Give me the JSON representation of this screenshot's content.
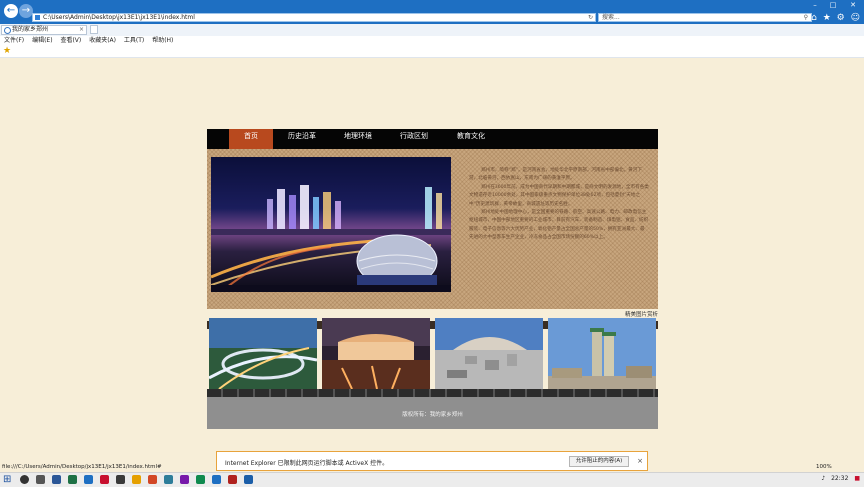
{
  "browser": {
    "address": "C:\\Users\\Admin\\Desktop\\jx13E1\\jx13E1\\index.html",
    "search_placeholder": "搜索...",
    "tab_title": "我的家乡郑州",
    "menu": [
      "文件(F)",
      "编辑(E)",
      "查看(V)",
      "收藏夹(A)",
      "工具(T)",
      "帮助(H)"
    ]
  },
  "site": {
    "nav": [
      "首页",
      "历史沿革",
      "地理环境",
      "行政区划",
      "教育文化"
    ],
    "active_nav": "首页",
    "intro": [
      "郑州市，简称“郑”，是河南省会，地处华北平原南部，河南省中部偏北，黄河下游，北临黄河，西依嵩山，东南为广阔的黄淮平原。",
      "郑州在3600年前，成为中国商代早期和中期都城，是商文明的发源地，全市有各类文物遗存近10000余处，其中国家级重点文物保护单位38处62项，包括夏封“天地之中”历史建筑群，黄帝故里，商城遗址等历史名胜。",
      "郑州地处中国地理中心，是全国重要的铁路、航空、高速公路、电力、邮政电信主枢纽城市，中国中部地区重要的工业城市，目前有汽车、装备制造、煤电铝、食品、纺织服装、电子信息等六大优势产业，氧化铝产量占全国总产量的50%，拥有亚洲最大、最先进的大中型客车生产企业，冷冻食品占全国市场份额的60%以上。"
    ],
    "more_link": "精美图片赏析",
    "copyright": "版权所有：我的家乡郑州"
  },
  "notification": {
    "text": "Internet Explorer 已限制此网页运行脚本或 ActiveX 控件。",
    "button": "允许阻止的内容(A)"
  },
  "status": {
    "url": "file:///C:/Users/Admin/Desktop/jx13E1/jx13E1/index.html#",
    "zoom": "100%"
  },
  "taskbar": {
    "time": "22:32"
  },
  "colors": {
    "chrome_blue": "#1e6fc2",
    "nav_active": "#b8491e",
    "notify_border": "#e8a33c"
  }
}
